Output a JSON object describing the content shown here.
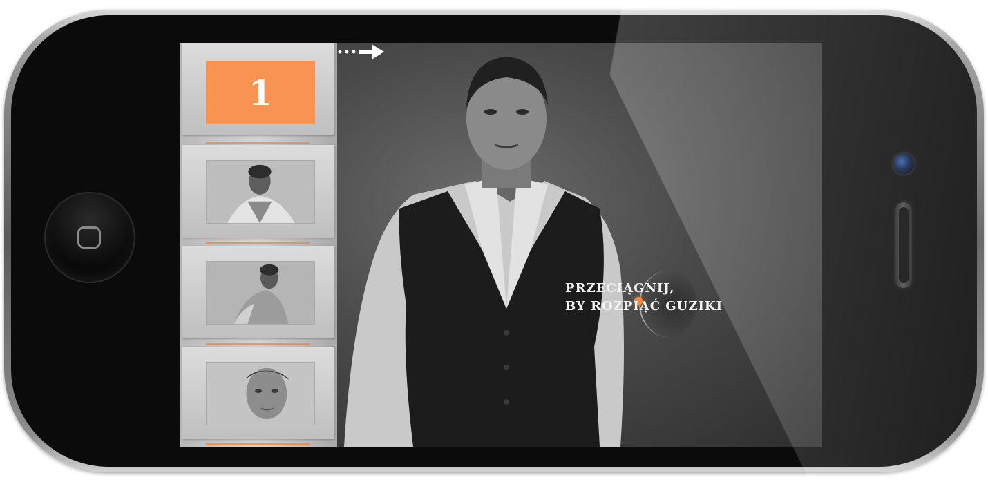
{
  "app": {
    "page_number": "1",
    "hint_line1": "PRZECIĄGNIJ,",
    "hint_line2": "BY ROZPIĄĆ GUZIKI"
  },
  "sidebar": {
    "thumbnails": [
      {
        "label": "thumbnail-portrait-1"
      },
      {
        "label": "thumbnail-portrait-2"
      },
      {
        "label": "thumbnail-portrait-3"
      }
    ]
  },
  "colors": {
    "accent": "#f99352",
    "handle": "#f28a3e",
    "hint_text": "#f2f2f2"
  },
  "icons": {
    "drag_arrow": "arrow-right-icon",
    "drag_handle": "drag-handle-icon",
    "home": "home-button-icon"
  }
}
